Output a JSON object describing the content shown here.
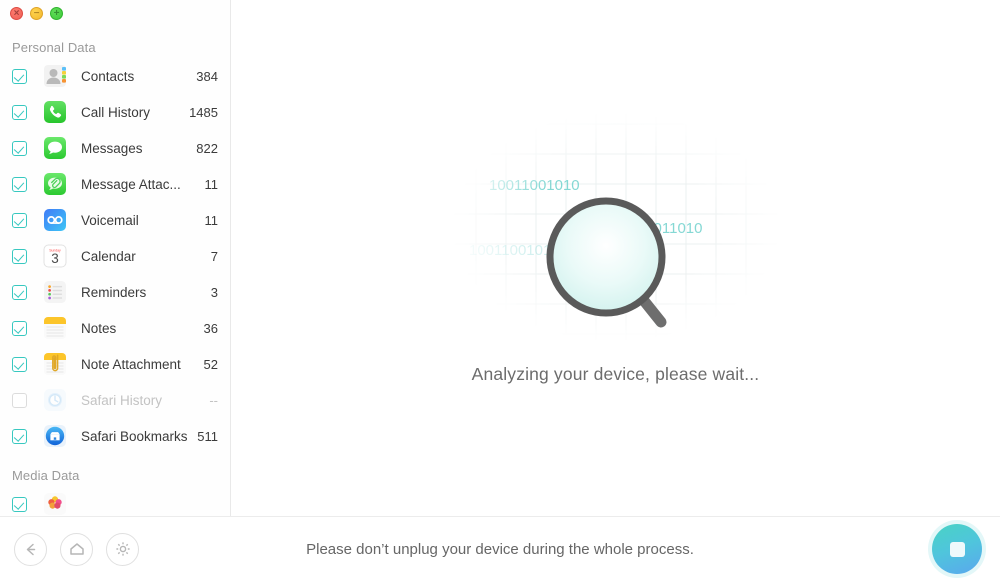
{
  "window": {
    "traffic_lights": [
      {
        "name": "close",
        "glyph": "×",
        "color": "#ec5f56"
      },
      {
        "name": "minimize",
        "glyph": "−",
        "color": "#f1b82e"
      },
      {
        "name": "maximize",
        "glyph": "+",
        "color": "#3ec93a"
      }
    ]
  },
  "sidebar": {
    "groups": [
      {
        "title": "Personal Data",
        "items": [
          {
            "label": "Contacts",
            "count": "384",
            "icon": "contacts-icon",
            "checked": true,
            "enabled": true
          },
          {
            "label": "Call History",
            "count": "1485",
            "icon": "call-history-icon",
            "checked": true,
            "enabled": true
          },
          {
            "label": "Messages",
            "count": "822",
            "icon": "messages-icon",
            "checked": true,
            "enabled": true
          },
          {
            "label": "Message Attac...",
            "count": "11",
            "icon": "message-attachments-icon",
            "checked": true,
            "enabled": true
          },
          {
            "label": "Voicemail",
            "count": "11",
            "icon": "voicemail-icon",
            "checked": true,
            "enabled": true
          },
          {
            "label": "Calendar",
            "count": "7",
            "icon": "calendar-icon",
            "checked": true,
            "enabled": true
          },
          {
            "label": "Reminders",
            "count": "3",
            "icon": "reminders-icon",
            "checked": true,
            "enabled": true
          },
          {
            "label": "Notes",
            "count": "36",
            "icon": "notes-icon",
            "checked": true,
            "enabled": true
          },
          {
            "label": "Note Attachment",
            "count": "52",
            "icon": "note-attachment-icon",
            "checked": true,
            "enabled": true
          },
          {
            "label": "Safari History",
            "count": "--",
            "icon": "safari-history-icon",
            "checked": false,
            "enabled": false
          },
          {
            "label": "Safari Bookmarks",
            "count": "511",
            "icon": "safari-bookmarks-icon",
            "checked": true,
            "enabled": true
          }
        ]
      },
      {
        "title": "Media Data",
        "items": [
          {
            "label": "",
            "count": "",
            "icon": "photos-icon",
            "checked": true,
            "enabled": true
          }
        ]
      }
    ]
  },
  "main": {
    "status_text": "Analyzing your device, please wait...",
    "artwork": {
      "name": "magnifier-binary-illustration",
      "binary_strings": [
        "10011001010",
        "00 01011010",
        "00010010010",
        "10011001010"
      ],
      "binary_color": "#7fd6d2",
      "lens_color": "#5a5a5a"
    }
  },
  "bottom_bar": {
    "message": "Please don’t unplug your device during the whole process.",
    "nav_buttons": [
      {
        "name": "back-button",
        "icon": "arrow-left-icon"
      },
      {
        "name": "home-button",
        "icon": "home-icon"
      },
      {
        "name": "settings-button",
        "icon": "gear-icon"
      }
    ],
    "stop_button": {
      "name": "stop-button",
      "icon": "stop-square-icon"
    }
  },
  "colors": {
    "accent_teal": "#38c8c0",
    "stop_gradient_start": "#49d3c4",
    "stop_gradient_end": "#5aa7ee",
    "text_primary": "#3b3b3b",
    "text_muted": "#9a9a9a"
  }
}
